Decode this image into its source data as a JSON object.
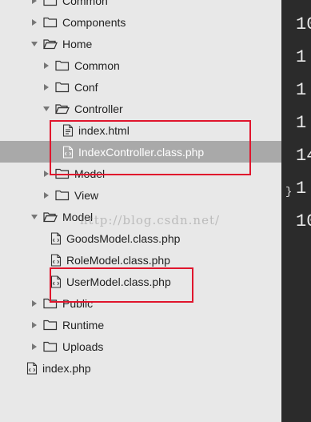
{
  "tree": [
    {
      "label": "Common",
      "kind": "folder",
      "state": "closed",
      "depth": 0,
      "selected": false
    },
    {
      "label": "Components",
      "kind": "folder",
      "state": "closed",
      "depth": 0,
      "selected": false
    },
    {
      "label": "Home",
      "kind": "folder",
      "state": "open",
      "depth": 0,
      "selected": false
    },
    {
      "label": "Common",
      "kind": "folder",
      "state": "closed",
      "depth": 1,
      "selected": false
    },
    {
      "label": "Conf",
      "kind": "folder",
      "state": "closed",
      "depth": 1,
      "selected": false
    },
    {
      "label": "Controller",
      "kind": "folder",
      "state": "open",
      "depth": 1,
      "selected": false
    },
    {
      "label": "index.html",
      "kind": "file-html",
      "depth": 2,
      "selected": false
    },
    {
      "label": "IndexController.class.php",
      "kind": "file-code",
      "depth": 2,
      "selected": true
    },
    {
      "label": "Model",
      "kind": "folder",
      "state": "closed",
      "depth": 1,
      "selected": false
    },
    {
      "label": "View",
      "kind": "folder",
      "state": "closed",
      "depth": 1,
      "selected": false
    },
    {
      "label": "Model",
      "kind": "folder",
      "state": "open",
      "depth": 0,
      "selected": false
    },
    {
      "label": "GoodsModel.class.php",
      "kind": "file-code",
      "depth": 1,
      "selected": false
    },
    {
      "label": "RoleModel.class.php",
      "kind": "file-code",
      "depth": 1,
      "selected": false
    },
    {
      "label": "UserModel.class.php",
      "kind": "file-code",
      "depth": 1,
      "selected": false
    },
    {
      "label": "Public",
      "kind": "folder",
      "state": "closed",
      "depth": 0,
      "selected": false
    },
    {
      "label": "Runtime",
      "kind": "folder",
      "state": "closed",
      "depth": 0,
      "selected": false
    },
    {
      "label": "Uploads",
      "kind": "folder",
      "state": "closed",
      "depth": 0,
      "selected": false
    },
    {
      "label": "index.php",
      "kind": "file-code",
      "depth": -1,
      "selected": false
    }
  ],
  "gutter": {
    "line_numbers": [
      "10",
      "1",
      "1",
      "1",
      "14",
      "1",
      "10"
    ],
    "brace": "}"
  },
  "watermark": "http://blog.csdn.net/",
  "colors": {
    "sidebar_bg": "#e8e8e8",
    "selected_bg": "#a9a9a9",
    "editor_bg": "#2b2b2b",
    "highlight": "#e0152d"
  }
}
